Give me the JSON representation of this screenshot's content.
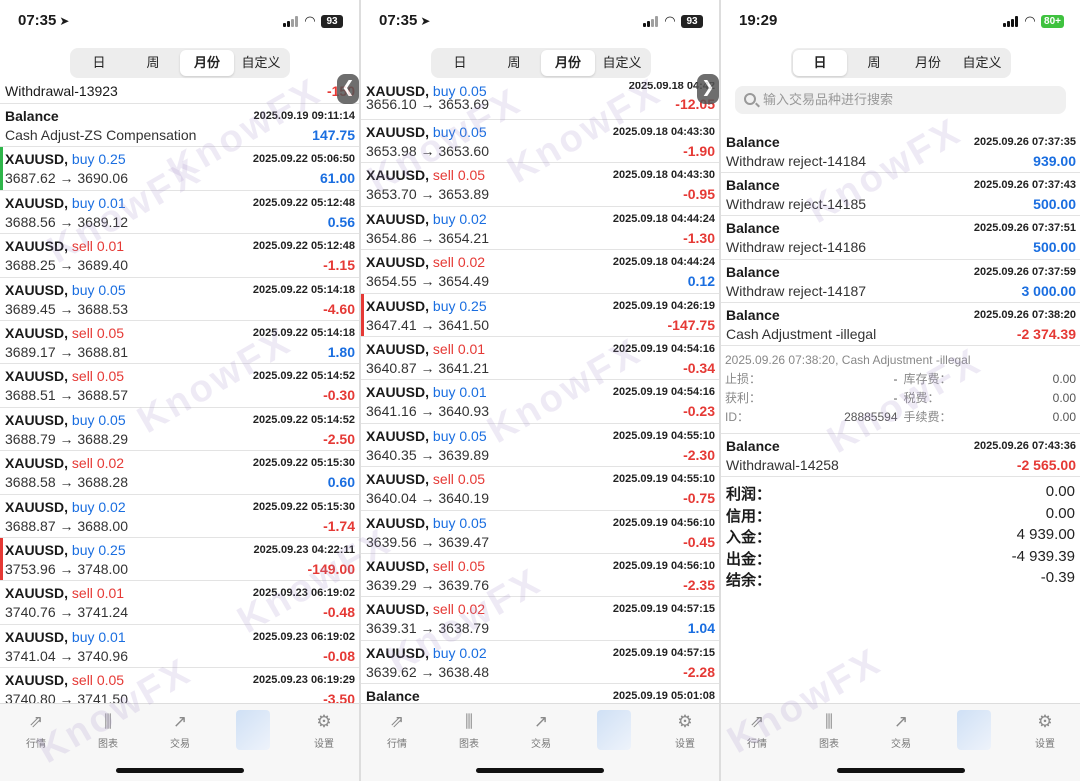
{
  "panels": [
    {
      "status": {
        "time": "07:35",
        "battery": "93"
      },
      "tabs": [
        "日",
        "周",
        "月份",
        "自定义"
      ],
      "selected_tab": 2,
      "rows": [
        {
          "sym": "Withdrawal-13923",
          "side": "",
          "lot": "",
          "time": "",
          "bot": "",
          "pl": "-150",
          "plc": "neg",
          "mark": "",
          "partial": true
        },
        {
          "sym": "Balance",
          "side": "",
          "lot": "",
          "time": "2025.09.19 09:11:14",
          "bot": "Cash Adjust-ZS Compensation",
          "pl": "147.75",
          "plc": "pos",
          "mark": ""
        },
        {
          "sym": "XAUUSD,",
          "side": "buy",
          "lot": "0.25",
          "time": "2025.09.22 05:06:50",
          "bot": "3687.62 → 3690.06",
          "pl": "61.00",
          "plc": "pos",
          "mark": "#2fb54a"
        },
        {
          "sym": "XAUUSD,",
          "side": "buy",
          "lot": "0.01",
          "time": "2025.09.22 05:12:48",
          "bot": "3688.56 → 3689.12",
          "pl": "0.56",
          "plc": "pos",
          "mark": ""
        },
        {
          "sym": "XAUUSD,",
          "side": "sell",
          "lot": "0.01",
          "time": "2025.09.22 05:12:48",
          "bot": "3688.25 → 3689.40",
          "pl": "-1.15",
          "plc": "neg",
          "mark": ""
        },
        {
          "sym": "XAUUSD,",
          "side": "buy",
          "lot": "0.05",
          "time": "2025.09.22 05:14:18",
          "bot": "3689.45 → 3688.53",
          "pl": "-4.60",
          "plc": "neg",
          "mark": ""
        },
        {
          "sym": "XAUUSD,",
          "side": "sell",
          "lot": "0.05",
          "time": "2025.09.22 05:14:18",
          "bot": "3689.17 → 3688.81",
          "pl": "1.80",
          "plc": "pos",
          "mark": ""
        },
        {
          "sym": "XAUUSD,",
          "side": "sell",
          "lot": "0.05",
          "time": "2025.09.22 05:14:52",
          "bot": "3688.51 → 3688.57",
          "pl": "-0.30",
          "plc": "neg",
          "mark": ""
        },
        {
          "sym": "XAUUSD,",
          "side": "buy",
          "lot": "0.05",
          "time": "2025.09.22 05:14:52",
          "bot": "3688.79 → 3688.29",
          "pl": "-2.50",
          "plc": "neg",
          "mark": ""
        },
        {
          "sym": "XAUUSD,",
          "side": "sell",
          "lot": "0.02",
          "time": "2025.09.22 05:15:30",
          "bot": "3688.58 → 3688.28",
          "pl": "0.60",
          "plc": "pos",
          "mark": ""
        },
        {
          "sym": "XAUUSD,",
          "side": "buy",
          "lot": "0.02",
          "time": "2025.09.22 05:15:30",
          "bot": "3688.87 → 3688.00",
          "pl": "-1.74",
          "plc": "neg",
          "mark": ""
        },
        {
          "sym": "XAUUSD,",
          "side": "buy",
          "lot": "0.25",
          "time": "2025.09.23 04:22:11",
          "bot": "3753.96 → 3748.00",
          "pl": "-149.00",
          "plc": "neg",
          "mark": "#e53935"
        },
        {
          "sym": "XAUUSD,",
          "side": "sell",
          "lot": "0.01",
          "time": "2025.09.23 06:19:02",
          "bot": "3740.76 → 3741.24",
          "pl": "-0.48",
          "plc": "neg",
          "mark": ""
        },
        {
          "sym": "XAUUSD,",
          "side": "buy",
          "lot": "0.01",
          "time": "2025.09.23 06:19:02",
          "bot": "3741.04 → 3740.96",
          "pl": "-0.08",
          "plc": "neg",
          "mark": ""
        },
        {
          "sym": "XAUUSD,",
          "side": "sell",
          "lot": "0.05",
          "time": "2025.09.23 06:19:29",
          "bot": "3740.80 → 3741.50",
          "pl": "-3.50",
          "plc": "neg",
          "mark": ""
        }
      ]
    },
    {
      "status": {
        "time": "07:35",
        "battery": "93"
      },
      "tabs": [
        "日",
        "周",
        "月份",
        "自定义"
      ],
      "selected_tab": 2,
      "rows": [
        {
          "sym": "XAUUSD,",
          "side": "buy",
          "lot": "0.05",
          "time": "2025.09.18 04:42",
          "bot": "3656.10 → 3653.69",
          "pl": "-12.05",
          "plc": "neg",
          "mark": "",
          "partial": true
        },
        {
          "sym": "XAUUSD,",
          "side": "buy",
          "lot": "0.05",
          "time": "2025.09.18 04:43:30",
          "bot": "3653.98 → 3653.60",
          "pl": "-1.90",
          "plc": "neg",
          "mark": ""
        },
        {
          "sym": "XAUUSD,",
          "side": "sell",
          "lot": "0.05",
          "time": "2025.09.18 04:43:30",
          "bot": "3653.70 → 3653.89",
          "pl": "-0.95",
          "plc": "neg",
          "mark": ""
        },
        {
          "sym": "XAUUSD,",
          "side": "buy",
          "lot": "0.02",
          "time": "2025.09.18 04:44:24",
          "bot": "3654.86 → 3654.21",
          "pl": "-1.30",
          "plc": "neg",
          "mark": ""
        },
        {
          "sym": "XAUUSD,",
          "side": "sell",
          "lot": "0.02",
          "time": "2025.09.18 04:44:24",
          "bot": "3654.55 → 3654.49",
          "pl": "0.12",
          "plc": "pos",
          "mark": ""
        },
        {
          "sym": "XAUUSD,",
          "side": "buy",
          "lot": "0.25",
          "time": "2025.09.19 04:26:19",
          "bot": "3647.41 → 3641.50",
          "pl": "-147.75",
          "plc": "neg",
          "mark": "#e53935"
        },
        {
          "sym": "XAUUSD,",
          "side": "sell",
          "lot": "0.01",
          "time": "2025.09.19 04:54:16",
          "bot": "3640.87 → 3641.21",
          "pl": "-0.34",
          "plc": "neg",
          "mark": ""
        },
        {
          "sym": "XAUUSD,",
          "side": "buy",
          "lot": "0.01",
          "time": "2025.09.19 04:54:16",
          "bot": "3641.16 → 3640.93",
          "pl": "-0.23",
          "plc": "neg",
          "mark": ""
        },
        {
          "sym": "XAUUSD,",
          "side": "buy",
          "lot": "0.05",
          "time": "2025.09.19 04:55:10",
          "bot": "3640.35 → 3639.89",
          "pl": "-2.30",
          "plc": "neg",
          "mark": ""
        },
        {
          "sym": "XAUUSD,",
          "side": "sell",
          "lot": "0.05",
          "time": "2025.09.19 04:55:10",
          "bot": "3640.04 → 3640.19",
          "pl": "-0.75",
          "plc": "neg",
          "mark": ""
        },
        {
          "sym": "XAUUSD,",
          "side": "buy",
          "lot": "0.05",
          "time": "2025.09.19 04:56:10",
          "bot": "3639.56 → 3639.47",
          "pl": "-0.45",
          "plc": "neg",
          "mark": ""
        },
        {
          "sym": "XAUUSD,",
          "side": "sell",
          "lot": "0.05",
          "time": "2025.09.19 04:56:10",
          "bot": "3639.29 → 3639.76",
          "pl": "-2.35",
          "plc": "neg",
          "mark": ""
        },
        {
          "sym": "XAUUSD,",
          "side": "sell",
          "lot": "0.02",
          "time": "2025.09.19 04:57:15",
          "bot": "3639.31 → 3638.79",
          "pl": "1.04",
          "plc": "pos",
          "mark": ""
        },
        {
          "sym": "XAUUSD,",
          "side": "buy",
          "lot": "0.02",
          "time": "2025.09.19 04:57:15",
          "bot": "3639.62 → 3638.48",
          "pl": "-2.28",
          "plc": "neg",
          "mark": ""
        },
        {
          "sym": "Balance",
          "side": "",
          "lot": "",
          "time": "2025.09.19 05:01:08",
          "bot": "",
          "pl": "",
          "plc": "",
          "mark": ""
        }
      ]
    }
  ],
  "panel3": {
    "status": {
      "time": "19:29",
      "battery": "80+"
    },
    "tabs": [
      "日",
      "周",
      "月份",
      "自定义"
    ],
    "selected_tab": 0,
    "search_placeholder": "输入交易品种进行搜索",
    "balance_rows": [
      {
        "sym": "Balance",
        "time": "2025.09.26 07:37:35",
        "bot": "Withdraw reject-14184",
        "pl": "939.00",
        "plc": "pos"
      },
      {
        "sym": "Balance",
        "time": "2025.09.26 07:37:43",
        "bot": "Withdraw reject-14185",
        "pl": "500.00",
        "plc": "pos"
      },
      {
        "sym": "Balance",
        "time": "2025.09.26 07:37:51",
        "bot": "Withdraw reject-14186",
        "pl": "500.00",
        "plc": "pos"
      },
      {
        "sym": "Balance",
        "time": "2025.09.26 07:37:59",
        "bot": "Withdraw reject-14187",
        "pl": "3 000.00",
        "plc": "pos"
      },
      {
        "sym": "Balance",
        "time": "2025.09.26 07:38:20",
        "bot": "Cash Adjustment -illegal",
        "pl": "-2 374.39",
        "plc": "neg"
      }
    ],
    "detail": {
      "header": "2025.09.26 07:38:20, Cash Adjustment -illegal",
      "lines": [
        {
          "k1": "止损：",
          "v1": "-",
          "k2": "库存费：",
          "v2": "0.00"
        },
        {
          "k1": "获利：",
          "v1": "-",
          "k2": "税费：",
          "v2": "0.00"
        },
        {
          "k1": "ID：",
          "v1": "28885594",
          "k2": "手续费：",
          "v2": "0.00"
        }
      ]
    },
    "last_row": {
      "sym": "Balance",
      "time": "2025.09.26 07:43:36",
      "bot": "Withdrawal-14258",
      "pl": "-2 565.00",
      "plc": "neg"
    },
    "summary": [
      {
        "k": "利润：",
        "v": "0.00"
      },
      {
        "k": "信用：",
        "v": "0.00"
      },
      {
        "k": "入金：",
        "v": "4 939.00"
      },
      {
        "k": "出金：",
        "v": "-4 939.39"
      },
      {
        "k": "结余：",
        "v": "-0.39"
      }
    ]
  },
  "tabbar": [
    {
      "label": "行情",
      "icon": "quotes-icon"
    },
    {
      "label": "图表",
      "icon": "chart-icon"
    },
    {
      "label": "交易",
      "icon": "trade-icon"
    },
    {
      "label": "",
      "icon": "blurred-icon"
    },
    {
      "label": "设置",
      "icon": "settings-icon"
    }
  ],
  "watermark": "KnowFX",
  "colors": {
    "buy": "#1a6ee0",
    "sell": "#e53935",
    "green_marker": "#2fb54a",
    "red_marker": "#e53935"
  }
}
